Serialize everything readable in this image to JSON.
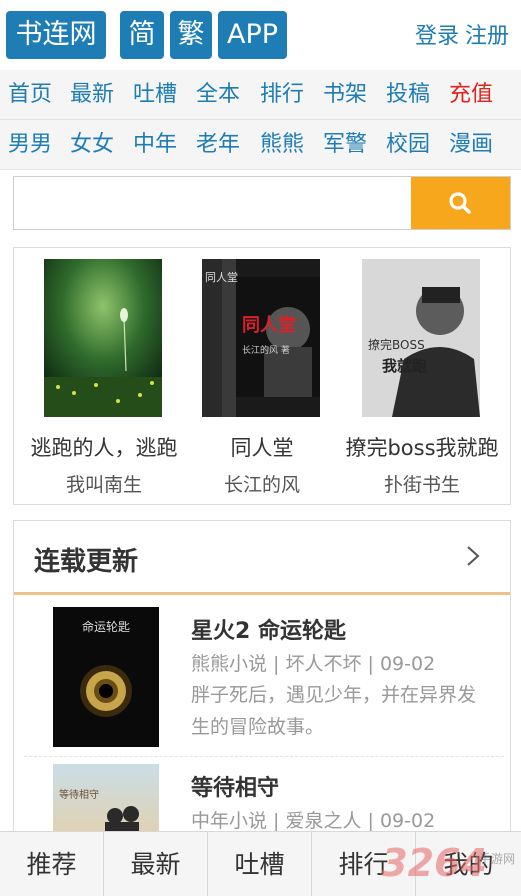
{
  "header": {
    "logo": "书连网",
    "simplified": "简",
    "traditional": "繁",
    "app": "APP",
    "login": "登录",
    "register": "注册"
  },
  "nav_primary": [
    "首页",
    "最新",
    "吐槽",
    "全本",
    "排行",
    "书架",
    "投稿",
    "充值"
  ],
  "nav_secondary": [
    "男男",
    "女女",
    "中年",
    "老年",
    "熊熊",
    "军警",
    "校园",
    "漫画"
  ],
  "search": {
    "placeholder": "",
    "button_icon": "search-icon"
  },
  "featured": [
    {
      "title": "逃跑的人，逃跑",
      "author": "我叫南生"
    },
    {
      "title": "同人堂",
      "author": "长江的风",
      "cover_text": "同人堂"
    },
    {
      "title": "撩完boss我就跑",
      "author": "扑街书生",
      "cover_text": "撩完BOSS我就跑"
    }
  ],
  "serial": {
    "title": "连载更新",
    "books": [
      {
        "name": "星火2 命运轮匙",
        "meta": "熊熊小说 | 坏人不坏 | 09-02",
        "desc": "胖子死后，遇见少年，并在异界发生的冒险故事。",
        "cover_text": "命运轮匙"
      },
      {
        "name": "等待相守",
        "meta": "中年小说 | 爱泉之人 | 09-02",
        "desc": ""
      }
    ]
  },
  "tabs": [
    "推荐",
    "最新",
    "吐槽",
    "排行",
    "我的"
  ],
  "watermark": {
    "big": "3264",
    "small": "手游网"
  },
  "colors": {
    "brand": "#1e7db5",
    "accent": "#f7a71b",
    "recharge": "#e0231b"
  }
}
